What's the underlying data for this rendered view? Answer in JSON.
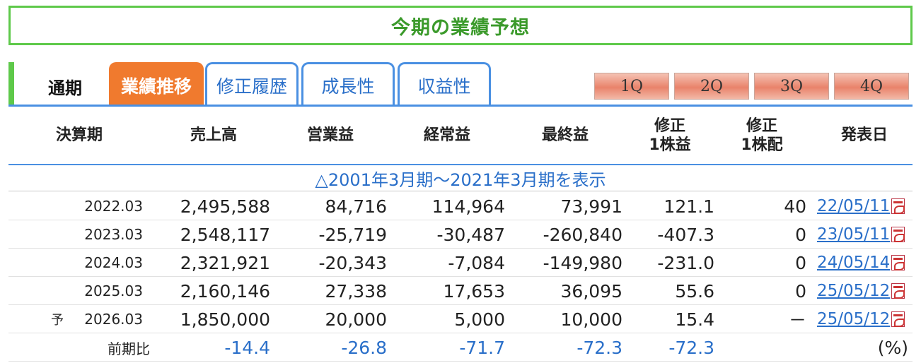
{
  "title": "今期の業績予想",
  "tabs": {
    "plain": "通期",
    "items": [
      {
        "label": "業績推移",
        "active": true
      },
      {
        "label": "修正履歴",
        "active": false
      },
      {
        "label": "成長性",
        "active": false
      },
      {
        "label": "収益性",
        "active": false
      }
    ],
    "quarters": [
      "1Q",
      "2Q",
      "3Q",
      "4Q"
    ]
  },
  "columns": [
    "決算期",
    "売上高",
    "営業益",
    "経常益",
    "最終益",
    "修正\n1株益",
    "修正\n1株配",
    "発表日"
  ],
  "expand_link": "△2001年3月期～2021年3月期を表示",
  "rows": [
    {
      "prefix": "",
      "period": "2022.03",
      "sales": "2,495,588",
      "op": "84,716",
      "ord": "114,964",
      "net": "73,991",
      "eps": "121.1",
      "div": "40",
      "date": "22/05/11"
    },
    {
      "prefix": "",
      "period": "2023.03",
      "sales": "2,548,117",
      "op": "-25,719",
      "ord": "-30,487",
      "net": "-260,840",
      "eps": "-407.3",
      "div": "0",
      "date": "23/05/11"
    },
    {
      "prefix": "",
      "period": "2024.03",
      "sales": "2,321,921",
      "op": "-20,343",
      "ord": "-7,084",
      "net": "-149,980",
      "eps": "-231.0",
      "div": "0",
      "date": "24/05/14"
    },
    {
      "prefix": "",
      "period": "2025.03",
      "sales": "2,160,146",
      "op": "27,338",
      "ord": "17,653",
      "net": "36,095",
      "eps": "55.6",
      "div": "0",
      "date": "25/05/12"
    },
    {
      "prefix": "予",
      "period": "2026.03",
      "sales": "1,850,000",
      "op": "20,000",
      "ord": "5,000",
      "net": "10,000",
      "eps": "15.4",
      "div": "－",
      "date": "25/05/12"
    }
  ],
  "ratio": {
    "label": "前期比",
    "sales": "-14.4",
    "op": "-26.8",
    "ord": "-71.7",
    "net": "-72.3",
    "eps": "-72.3",
    "unit": "(%)"
  },
  "colors": {
    "green": "#5ec94a",
    "blue": "#4a90e2",
    "orange": "#f07a2e",
    "link": "#2a6fc9"
  }
}
